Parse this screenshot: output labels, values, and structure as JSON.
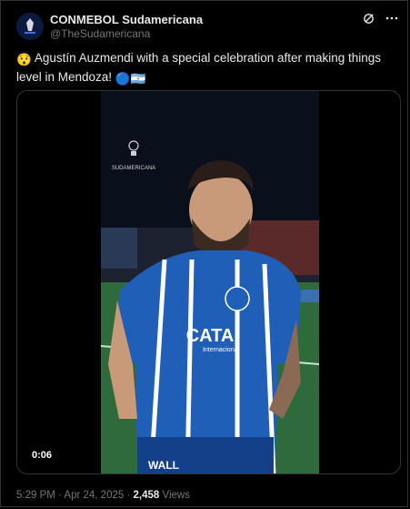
{
  "account": {
    "name": "CONMEBOL Sudamericana",
    "handle": "@TheSudamericana"
  },
  "tweet": {
    "emoji_lead": "😯",
    "text": "Agustín Auzmendi with a special celebration after making things level in Mendoza!",
    "emoji_trail": [
      "🔵",
      "🇦🇷"
    ]
  },
  "video": {
    "timestamp": "0:06",
    "watermark": "SUDAMERICANA",
    "jersey_sponsor": "CATA",
    "jersey_sponsor_sub": "Internacional",
    "ad_text": "WALL"
  },
  "meta": {
    "time": "5:29 PM · Apr 24, 2025 · ",
    "views_count": "2,458",
    "views_label": " Views"
  },
  "colors": {
    "background": "#000000",
    "text": "#e7e9ea",
    "muted": "#71767b",
    "border": "#2f3336",
    "jersey": "#1f5fb8"
  }
}
